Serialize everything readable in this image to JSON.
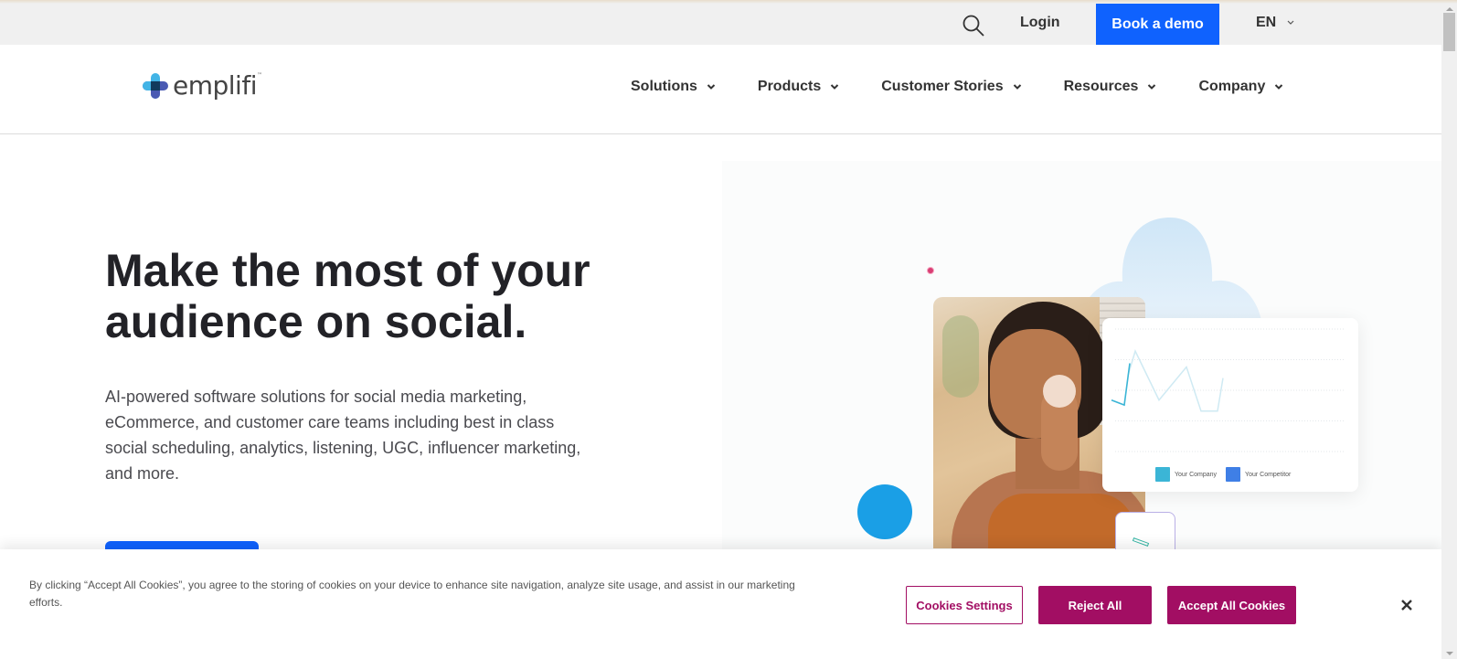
{
  "utility_bar": {
    "search_icon": "search-icon",
    "login_label": "Login",
    "demo_label": "Book a demo",
    "language": "EN",
    "demo_color": "#0f62fe"
  },
  "nav": {
    "logo_text": "emplifi",
    "logo_tm": "™",
    "items": [
      {
        "label": "Solutions"
      },
      {
        "label": "Products"
      },
      {
        "label": "Customer Stories"
      },
      {
        "label": "Resources"
      },
      {
        "label": "Company"
      }
    ]
  },
  "hero": {
    "title": "Make the most of your audience on social.",
    "description": "AI-powered software solutions for social media marketing, eCommerce, and customer care teams including best in class social scheduling, analytics, listening, UGC, influencer marketing, and more.",
    "illustration": {
      "legend": [
        {
          "label": "Your Company",
          "color": "#3bb5d6"
        },
        {
          "label": "Your Competitor",
          "color": "#3f7fe6"
        }
      ],
      "series_your_company": [
        0.42,
        0.38,
        0.72
      ],
      "series_your_competitor": [
        0.82,
        0.42,
        0.69,
        0.33,
        0.33,
        0.6
      ]
    }
  },
  "cookie_banner": {
    "text": "By clicking “Accept All Cookies”, you agree to the storing of cookies on your device to enhance site navigation, analyze site usage, and assist in our marketing efforts.",
    "settings_label": "Cookies Settings",
    "reject_label": "Reject All",
    "accept_label": "Accept All Cookies",
    "accent_color": "#a20e63"
  }
}
